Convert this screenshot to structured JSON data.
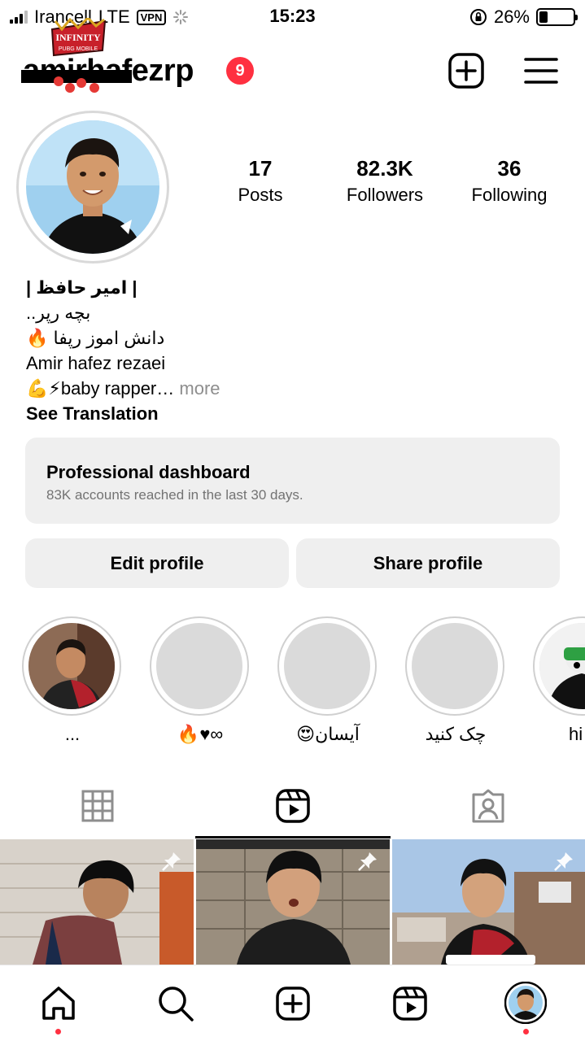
{
  "status_bar": {
    "carrier": "Irancell",
    "network": "LTE",
    "vpn": "VPN",
    "time": "15:23",
    "battery_pct": "26%",
    "battery_level": 0.26
  },
  "header": {
    "username": "amirhafezrp",
    "notification_count": "9",
    "logo_text_top": "INFINITY",
    "logo_text_sub": "PUBG MOBILE"
  },
  "stats": {
    "posts_count": "17",
    "posts_label": "Posts",
    "followers_count": "82.3K",
    "followers_label": "Followers",
    "following_count": "36",
    "following_label": "Following"
  },
  "bio": {
    "name": "| امیر حافظ |",
    "line1": "بچه رپر..",
    "line2": "دانش اموز رپفا 🔥",
    "line3": "Amir hafez rezaei",
    "line4": "💪⚡baby rapper…",
    "more": "more",
    "see_translation": "See Translation"
  },
  "dashboard": {
    "title": "Professional dashboard",
    "subtitle": "83K accounts reached in the last 30 days."
  },
  "buttons": {
    "edit_profile": "Edit profile",
    "share_profile": "Share profile"
  },
  "highlights": [
    {
      "caption": "..."
    },
    {
      "caption": "🔥♥∞"
    },
    {
      "caption": "آیسان😍"
    },
    {
      "caption": "چک کنید"
    },
    {
      "caption": "hi"
    }
  ],
  "tabs": [
    {
      "icon": "grid-icon",
      "active": false
    },
    {
      "icon": "reels-icon",
      "active": true
    },
    {
      "icon": "tagged-icon",
      "active": false
    }
  ],
  "bottom_nav": [
    {
      "icon": "home-icon",
      "dot": true
    },
    {
      "icon": "search-icon",
      "dot": false
    },
    {
      "icon": "create-icon",
      "dot": false
    },
    {
      "icon": "reels-icon",
      "dot": false
    },
    {
      "icon": "profile-avatar",
      "dot": true
    }
  ],
  "colors": {
    "badge": "#ff3040",
    "button_bg": "#efefef",
    "muted_text": "#737373"
  }
}
